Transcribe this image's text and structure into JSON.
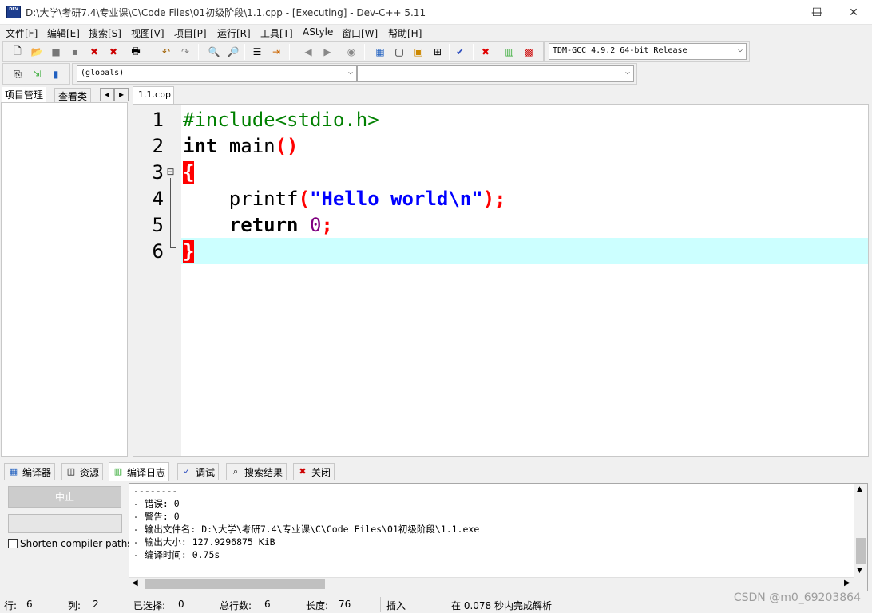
{
  "window": {
    "title": "D:\\大学\\考研7.4\\专业课\\C\\Code Files\\01初级阶段\\1.1.cpp - [Executing] - Dev-C++ 5.11",
    "app_icon_text": "DEV",
    "minimize": "—",
    "maximize": "☐",
    "close": "✕"
  },
  "menu": [
    "文件[F]",
    "编辑[E]",
    "搜索[S]",
    "视图[V]",
    "项目[P]",
    "运行[R]",
    "工具[T]",
    "AStyle",
    "窗口[W]",
    "帮助[H]"
  ],
  "toolbar": {
    "compiler_select": "TDM-GCC 4.9.2 64-bit Release",
    "globals_select": "(globals)",
    "member_select": ""
  },
  "left_panel": {
    "tabs": [
      "项目管理",
      "查看类"
    ],
    "nav_prev": "◂",
    "nav_next": "▸"
  },
  "editor": {
    "tab_label": "1.1.cpp",
    "line_numbers": [
      "1",
      "2",
      "3",
      "4",
      "5",
      "6"
    ],
    "fold_marker": "⊟",
    "line1": "#include<stdio.h>",
    "line2_kw": "int",
    "line2_rest": " main",
    "line2_parens": "()",
    "line3": "{",
    "line4_indent": "    ",
    "line4_fn": "printf",
    "line4_open": "(",
    "line4_str": "\"Hello world\\n\"",
    "line4_close": ");",
    "line5_indent": "    ",
    "line5_kw": "return",
    "line5_space": " ",
    "line5_num": "0",
    "line5_end": ";",
    "line6": "}"
  },
  "bottom_tabs": [
    {
      "label": "编译器",
      "icon": "▦"
    },
    {
      "label": "资源",
      "icon": "◫"
    },
    {
      "label": "编译日志",
      "icon": "▥"
    },
    {
      "label": "调试",
      "icon": "✓"
    },
    {
      "label": "搜索结果",
      "icon": "⌕"
    },
    {
      "label": "关闭",
      "icon": "✖"
    }
  ],
  "compile_panel": {
    "abort_label": "中止",
    "shorten_label": "Shorten compiler paths",
    "log_lines": [
      "--------",
      "- 错误: 0",
      "- 警告: 0",
      "- 输出文件名: D:\\大学\\考研7.4\\专业课\\C\\Code Files\\01初级阶段\\1.1.exe",
      "- 输出大小: 127.9296875 KiB",
      "- 编译时间: 0.75s"
    ]
  },
  "statusbar": {
    "row_label": "行:",
    "row_value": "6",
    "col_label": "列:",
    "col_value": "2",
    "sel_label": "已选择:",
    "sel_value": "0",
    "total_label": "总行数:",
    "total_value": "6",
    "len_label": "长度:",
    "len_value": "76",
    "mode": "插入",
    "parse_msg": "在 0.078 秒内完成解析"
  },
  "watermark": "CSDN @m0_69203864",
  "colors": {
    "current_line": "#ccffff",
    "keyword": "#000000",
    "preprocessor": "#008000",
    "string": "#0000ff",
    "number": "#800080",
    "brace_highlight": "#ff0000"
  }
}
